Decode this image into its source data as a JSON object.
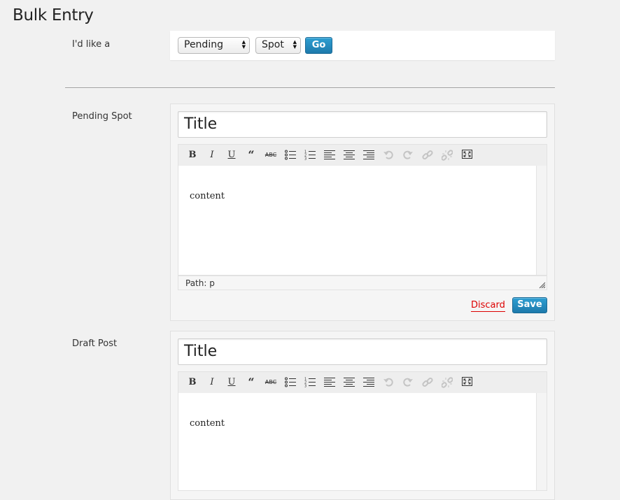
{
  "page": {
    "title": "Bulk Entry"
  },
  "chooser": {
    "label": "I'd like a",
    "status_select": {
      "value": "Pending"
    },
    "type_select": {
      "value": "Spot"
    },
    "go_label": "Go"
  },
  "entries": [
    {
      "label": "Pending Spot",
      "title_value": "Title",
      "content": "content",
      "path": "Path: p",
      "discard_label": "Discard",
      "save_label": "Save"
    },
    {
      "label": "Draft Post",
      "title_value": "Title",
      "content": "content"
    }
  ],
  "toolbar_icons": [
    "bold-icon",
    "italic-icon",
    "underline-icon",
    "blockquote-icon",
    "strikethrough-icon",
    "bullet-list-icon",
    "numbered-list-icon",
    "align-left-icon",
    "align-center-icon",
    "align-right-icon",
    "undo-icon",
    "redo-icon",
    "link-icon",
    "unlink-icon",
    "fullscreen-icon"
  ],
  "colors": {
    "button_blue": "#2183b9",
    "discard_red": "#dd0000",
    "background": "#f1f1f1"
  }
}
